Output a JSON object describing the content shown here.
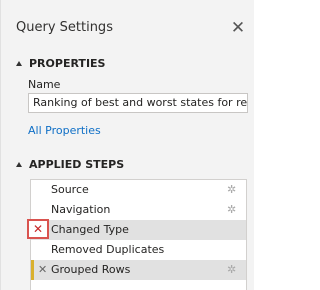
{
  "pane": {
    "title": "Query Settings",
    "close_icon": "close-icon"
  },
  "properties": {
    "header": "PROPERTIES",
    "name_label": "Name",
    "name_value": "Ranking of best and worst states for retire",
    "all_properties_link": "All Properties"
  },
  "applied_steps": {
    "header": "APPLIED STEPS",
    "items": [
      {
        "label": "Source",
        "has_gear": true,
        "selected": false
      },
      {
        "label": "Navigation",
        "has_gear": true,
        "selected": false
      },
      {
        "label": "Changed Type",
        "has_gear": false,
        "selected": true,
        "delete_icon": "delete-step-icon"
      },
      {
        "label": "Removed Duplicates",
        "has_gear": false,
        "selected": false
      },
      {
        "label": "Grouped Rows",
        "has_gear": true,
        "selected": false,
        "marker": "yellow"
      }
    ]
  },
  "colors": {
    "background": "#f3f3f3",
    "link": "#0f6fc6",
    "delete_border": "#d9534f",
    "warning_marker": "#d9b02e"
  }
}
